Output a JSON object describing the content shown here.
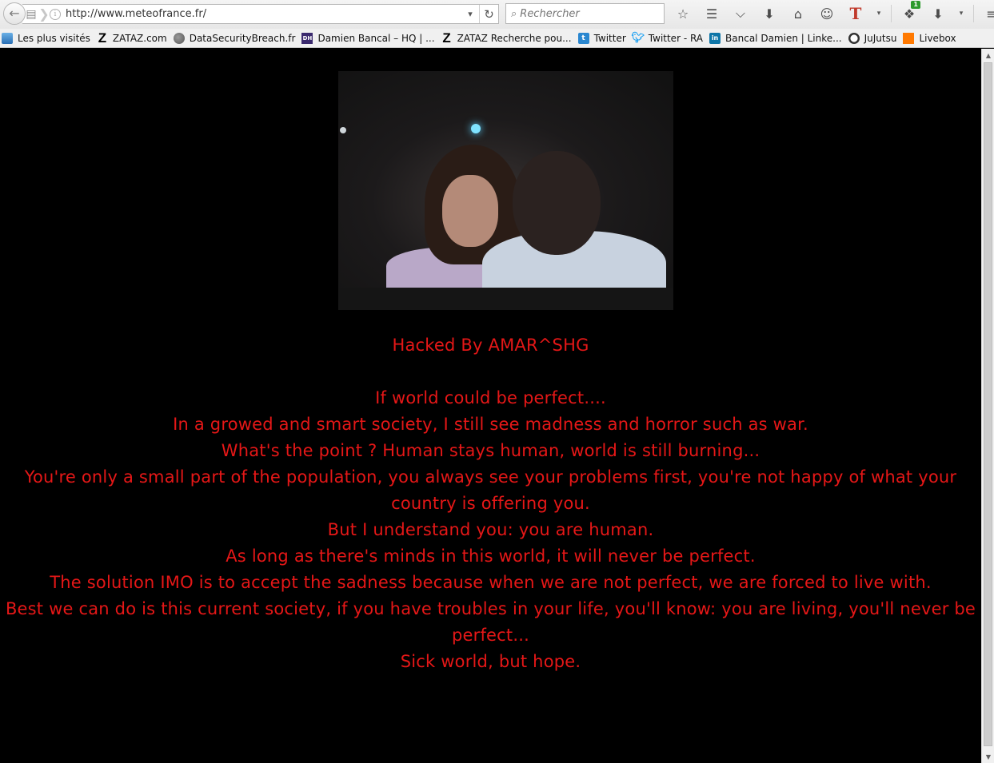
{
  "browser": {
    "url": "http://www.meteofrance.fr/",
    "search_placeholder": "Rechercher",
    "notification_count": "1",
    "bookmarks": [
      {
        "label": "Les plus visités",
        "icon": "most-visited-icon"
      },
      {
        "label": "ZATAZ.com",
        "icon": "zataz-icon"
      },
      {
        "label": "DataSecurityBreach.fr",
        "icon": "globe-icon"
      },
      {
        "label": "Damien Bancal – HQ | ...",
        "icon": "dh-icon"
      },
      {
        "label": "ZATAZ Recherche pou...",
        "icon": "zataz-icon"
      },
      {
        "label": "Twitter",
        "icon": "twitter-box-icon"
      },
      {
        "label": "Twitter - RA",
        "icon": "twitter-icon"
      },
      {
        "label": "Bancal Damien | Linke...",
        "icon": "linkedin-icon"
      },
      {
        "label": "JuJutsu",
        "icon": "panda-icon"
      },
      {
        "label": "Livebox",
        "icon": "orange-icon"
      }
    ]
  },
  "page": {
    "title": "Hacked By AMAR^SHG",
    "lines": [
      "If world could be perfect....",
      "In a growed and smart society, I still see madness and horror such as war.",
      "What's the point ? Human stays human, world is still burning...",
      "You're only a small part of the population, you always see your problems first, you're not happy of what your country is offering you.",
      "But I understand you: you are human.",
      "As long as there's minds in this world, it will never be perfect.",
      "The solution IMO is to accept the sadness because when we are not perfect, we are forced to live with.",
      "Best we can do is this current society, if you have troubles in your life, you'll know: you are living, you'll never be perfect...",
      "Sick world, but hope."
    ],
    "colors": {
      "text": "#e51717",
      "background": "#000000"
    }
  }
}
